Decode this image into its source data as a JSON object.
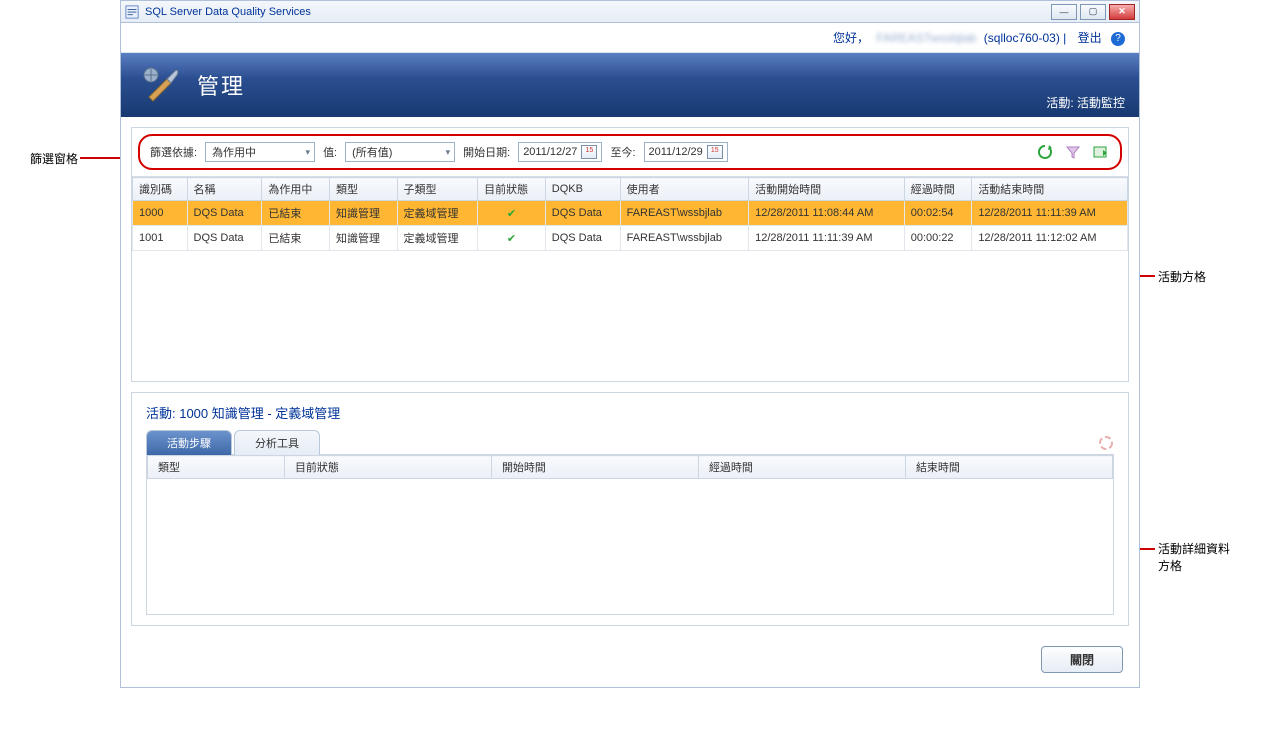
{
  "window": {
    "title": "SQL Server Data Quality Services"
  },
  "greeting": {
    "hello": "您好，",
    "blurred": "FAREASTwssbjlab",
    "server": "(sqlloc760-03)",
    "sep": "|",
    "logout": "登出"
  },
  "banner": {
    "title": "管理",
    "breadcrumb": "活動: 活動監控"
  },
  "filter": {
    "filterByLabel": "篩選依據:",
    "filterByValue": "為作用中",
    "valueLabel": "值:",
    "valueValue": "(所有值)",
    "startLabel": "開始日期:",
    "startDate": "2011/12/27",
    "toLabel": "至今:",
    "endDate": "2011/12/29"
  },
  "activityGrid": {
    "headers": [
      "識別碼",
      "名稱",
      "為作用中",
      "類型",
      "子類型",
      "目前狀態",
      "DQKB",
      "使用者",
      "活動開始時間",
      "經過時間",
      "活動結束時間"
    ],
    "rows": [
      {
        "id": "1000",
        "name": "DQS Data",
        "active": "已結束",
        "type": "知識管理",
        "subtype": "定義域管理",
        "status": "✓",
        "dqkb": "DQS Data",
        "user": "FAREAST\\wssbjlab",
        "start": "12/28/2011 11:08:44 AM",
        "elapsed": "00:02:54",
        "end": "12/28/2011 11:11:39 AM",
        "selected": true
      },
      {
        "id": "1001",
        "name": "DQS Data",
        "active": "已結束",
        "type": "知識管理",
        "subtype": "定義域管理",
        "status": "✓",
        "dqkb": "DQS Data",
        "user": "FAREAST\\wssbjlab",
        "start": "12/28/2011 11:11:39 AM",
        "elapsed": "00:00:22",
        "end": "12/28/2011 11:12:02 AM",
        "selected": false
      }
    ]
  },
  "detail": {
    "title": "活動:  1000 知識管理 - 定義域管理",
    "tabs": {
      "steps": "活動步驟",
      "profiler": "分析工具"
    },
    "stepHeaders": [
      "類型",
      "目前狀態",
      "開始時間",
      "經過時間",
      "結束時間"
    ]
  },
  "footer": {
    "close": "關閉"
  },
  "annotations": {
    "filterPane": "篩選窗格",
    "activityGrid": "活動方格",
    "detailGrid": "活動詳細資料方格"
  }
}
